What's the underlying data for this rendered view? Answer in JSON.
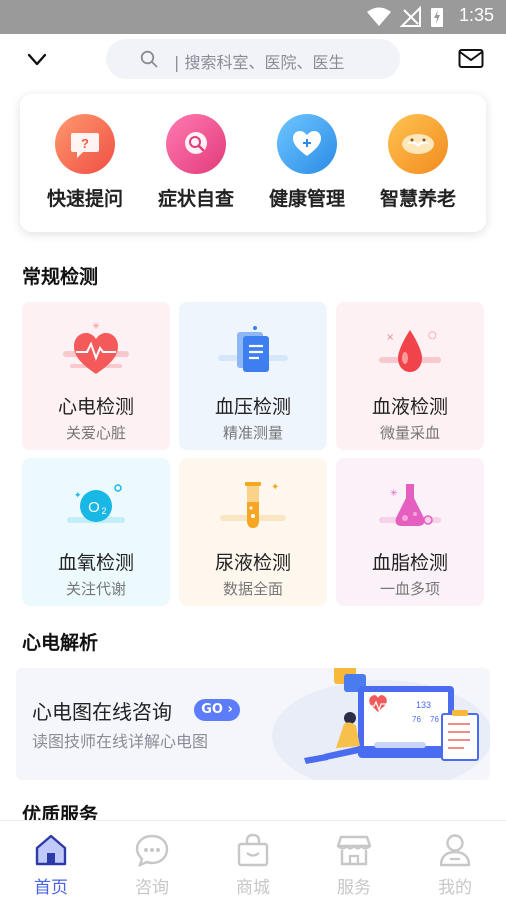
{
  "status_bar": {
    "time": "1:35"
  },
  "search": {
    "placeholder": "| 搜索科室、医院、医生"
  },
  "quick_actions": [
    {
      "label": "快速提问",
      "icon": "question-bubble-icon",
      "color": "#f56b52"
    },
    {
      "label": "症状自查",
      "icon": "magnifier-bubble-icon",
      "color": "#f2508c"
    },
    {
      "label": "健康管理",
      "icon": "heart-plus-icon",
      "color": "#3aa3f0"
    },
    {
      "label": "智慧养老",
      "icon": "elder-face-icon",
      "color": "#f8a43a"
    }
  ],
  "routine_section": {
    "title": "常规检测"
  },
  "tests": [
    {
      "name": "心电检测",
      "sub": "关爱心脏",
      "icon": "ecg-heart-icon",
      "bg": "#fdf1f3"
    },
    {
      "name": "血压检测",
      "sub": "精准测量",
      "icon": "bp-document-icon",
      "bg": "#eff5fd"
    },
    {
      "name": "血液检测",
      "sub": "微量采血",
      "icon": "blood-drop-icon",
      "bg": "#fdf1f3"
    },
    {
      "name": "血氧检测",
      "sub": "关注代谢",
      "icon": "oxygen-o2-icon",
      "bg": "#ecfafd"
    },
    {
      "name": "尿液检测",
      "sub": "数据全面",
      "icon": "test-tube-icon",
      "bg": "#fdf7ee"
    },
    {
      "name": "血脂检测",
      "sub": "一血多项",
      "icon": "lipid-flask-icon",
      "bg": "#fbf1f8"
    }
  ],
  "ecg_section": {
    "title": "心电解析",
    "banner_title": "心电图在线咨询",
    "go_label": "GO",
    "banner_sub": "读图技师在线详解心电图",
    "illo_numbers": [
      "133",
      "76",
      "76"
    ]
  },
  "quality_section": {
    "title": "优质服务"
  },
  "tabs": [
    {
      "label": "首页",
      "icon": "home-icon",
      "active": true
    },
    {
      "label": "咨询",
      "icon": "chat-icon",
      "active": false
    },
    {
      "label": "商城",
      "icon": "shopping-bag-icon",
      "active": false
    },
    {
      "label": "服务",
      "icon": "store-icon",
      "active": false
    },
    {
      "label": "我的",
      "icon": "user-icon",
      "active": false
    }
  ]
}
